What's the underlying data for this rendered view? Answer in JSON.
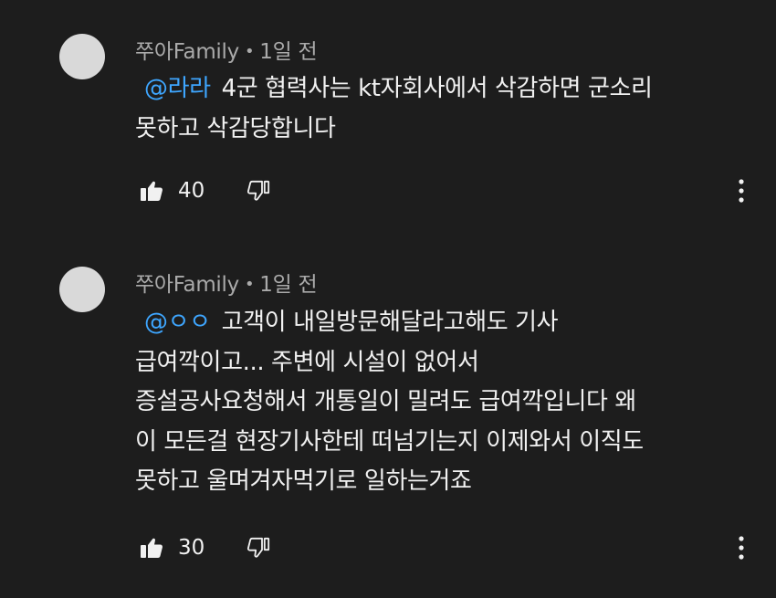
{
  "comments": [
    {
      "author": "쭈아Family",
      "separator": "•",
      "time": "1일 전",
      "mention": "@라라",
      "lines": [
        "4군 협력사는 kt자회사에서 삭감하면 군소리",
        "못하고 삭감당합니다"
      ],
      "likes": "40",
      "icons": {
        "like": "thumbs-up-icon",
        "dislike": "thumbs-down-icon",
        "more": "more-vertical-icon"
      }
    },
    {
      "author": "쭈아Family",
      "separator": "•",
      "time": "1일 전",
      "mention": "@ㅇㅇ",
      "lines": [
        "고객이 내일방문해달라고해도 기사",
        "급여깍이고... 주변에 시설이 없어서",
        "증설공사요청해서 개통일이 밀려도 급여깍입니다 왜",
        "이 모든걸 현장기사한테 떠넘기는지 이제와서 이직도",
        "못하고 울며겨자먹기로 일하는거죠"
      ],
      "likes": "30",
      "icons": {
        "like": "thumbs-up-icon",
        "dislike": "thumbs-down-icon",
        "more": "more-vertical-icon"
      }
    }
  ],
  "colors": {
    "background": "#1d1d1d",
    "text": "#f1f1f1",
    "meta": "#aaaaaa",
    "mention": "#3ea6ff",
    "avatar": "#d9d9d9"
  }
}
